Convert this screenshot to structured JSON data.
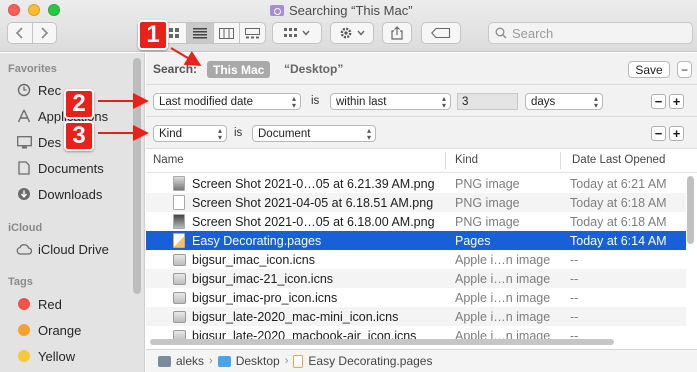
{
  "window": {
    "title": "Searching “This Mac”"
  },
  "toolbar": {
    "back_icon": "chevron-left-icon",
    "forward_icon": "chevron-right-icon",
    "view_modes": [
      "icon-view",
      "list-view",
      "column-view",
      "gallery-view"
    ],
    "active_view": "list-view",
    "search_placeholder": "Search"
  },
  "sidebar": {
    "favorites_title": "Favorites",
    "favorites": [
      {
        "label": "Rec",
        "icon": "clock-icon"
      },
      {
        "label": "Applications",
        "icon": "applications-icon"
      },
      {
        "label": "Des",
        "icon": "desktop-icon"
      },
      {
        "label": "Documents",
        "icon": "document-icon"
      },
      {
        "label": "Downloads",
        "icon": "download-icon"
      }
    ],
    "icloud_title": "iCloud",
    "icloud": [
      {
        "label": "iCloud Drive",
        "icon": "cloud-icon"
      }
    ],
    "tags_title": "Tags",
    "tags": [
      {
        "label": "Red",
        "color": "#f0524b"
      },
      {
        "label": "Orange",
        "color": "#f5a033"
      },
      {
        "label": "Yellow",
        "color": "#f5c93a"
      }
    ]
  },
  "search_scope": {
    "label": "Search:",
    "this_mac": "This Mac",
    "desktop": "“Desktop”",
    "save": "Save",
    "minus": "−"
  },
  "criteria": [
    {
      "attribute": "Last modified date",
      "op_label": "is",
      "op": "within last",
      "value": "3",
      "unit": "days"
    },
    {
      "attribute": "Kind",
      "op_label": "is",
      "value": "Document"
    }
  ],
  "list": {
    "columns": {
      "name": "Name",
      "kind": "Kind",
      "date": "Date Last Opened"
    },
    "rows": [
      {
        "name": "Screen Shot 2021-0…05 at 6.21.39 AM.png",
        "kind": "PNG image",
        "date": "Today at 6:21 AM",
        "icon": "image"
      },
      {
        "name": "Screen Shot 2021-04-05 at 6.18.51 AM.png",
        "kind": "PNG image",
        "date": "Today at 6:18 AM",
        "icon": "image-light"
      },
      {
        "name": "Screen Shot 2021-0…05 at 6.18.00 AM.png",
        "kind": "PNG image",
        "date": "Today at 6:18 AM",
        "icon": "image-dark"
      },
      {
        "name": "Easy Decorating.pages",
        "kind": "Pages",
        "date": "Today at 6:14 AM",
        "icon": "pages",
        "selected": true
      },
      {
        "name": "bigsur_imac_icon.icns",
        "kind": "Apple i…n image",
        "date": "--",
        "icon": "icns"
      },
      {
        "name": "bigsur_imac-21_icon.icns",
        "kind": "Apple i…n image",
        "date": "--",
        "icon": "icns"
      },
      {
        "name": "bigsur_imac-pro_icon.icns",
        "kind": "Apple i…n image",
        "date": "--",
        "icon": "icns"
      },
      {
        "name": "bigsur_late-2020_mac-mini_icon.icns",
        "kind": "Apple i…n image",
        "date": "--",
        "icon": "icns"
      },
      {
        "name": "bigsur_late-2020_macbook-air_icon.icns",
        "kind": "Apple i…n image",
        "date": "--",
        "icon": "icns"
      }
    ]
  },
  "path_bar": [
    "aleks",
    "Desktop",
    "Easy Decorating.pages"
  ],
  "annotations": [
    {
      "number": "1",
      "color": "#e8211a"
    },
    {
      "number": "2",
      "color": "#e8211a"
    },
    {
      "number": "3",
      "color": "#e8211a"
    }
  ]
}
